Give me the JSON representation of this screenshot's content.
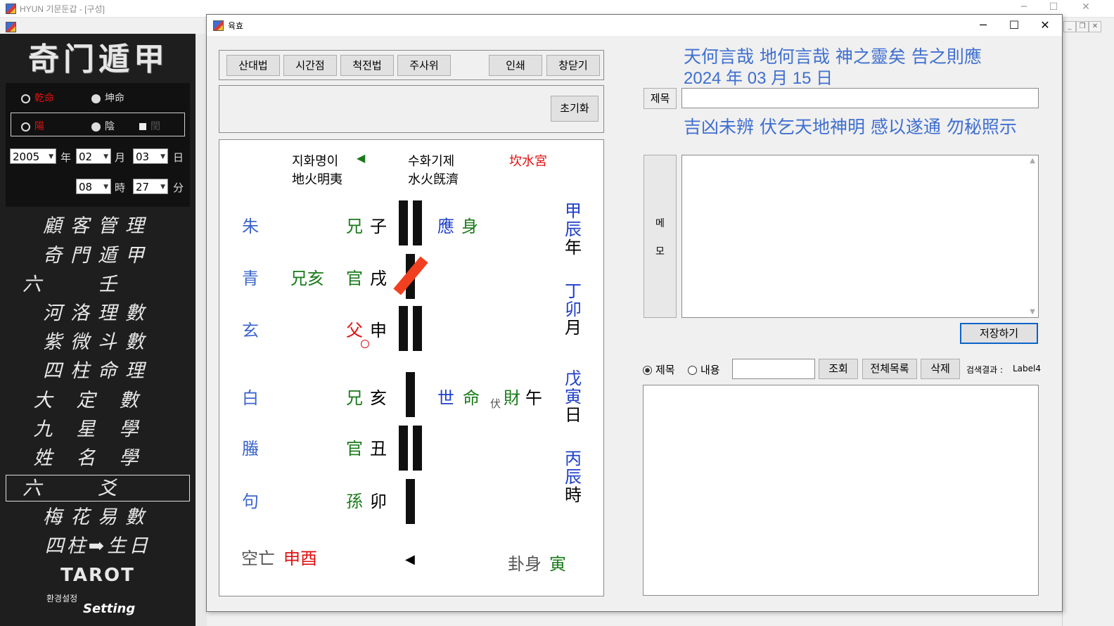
{
  "main_window": {
    "title": "HYUN 기문둔갑 - [구성]"
  },
  "left_panel": {
    "logo": "奇门遁甲",
    "gender": {
      "male": "乾命",
      "female": "坤命",
      "selected": "male"
    },
    "calendar": {
      "solar": "陽",
      "lunar": "陰",
      "leap": "閏",
      "selected": "solar"
    },
    "date": {
      "year": "2005",
      "year_unit": "年",
      "month": "02",
      "month_unit": "月",
      "day": "03",
      "day_unit": "日"
    },
    "time": {
      "hour": "08",
      "hour_unit": "時",
      "minute": "27",
      "minute_unit": "分"
    },
    "menu": [
      "顧客管理",
      "奇門遁甲",
      "六壬",
      "河洛理數",
      "紫微斗數",
      "四柱命理",
      "大定數",
      "九星學",
      "姓名學",
      "六爻",
      "梅花易數",
      "四柱➡生日",
      "TAROT"
    ],
    "active_menu": "六爻",
    "settings_ko": "환경설정",
    "settings_en": "Setting"
  },
  "dialog": {
    "title": "육효",
    "toolbar": [
      "산대법",
      "시간점",
      "척전법",
      "주사위"
    ],
    "print_label": "인쇄",
    "close_label": "창닫기",
    "reset_label": "초기화",
    "hexagram": {
      "name_ko": "지화명이",
      "arrow": "◀",
      "name_hanja": "地火明夷",
      "changed_ko": "수화기제",
      "changed_hanja": "水火旣濟",
      "palace": "坎水宮",
      "lines": [
        {
          "spirit": "朱",
          "hidden": "",
          "relation": "兄",
          "branch": "子",
          "mark": "應",
          "extra": "身",
          "fushen_tag": "",
          "fushen": "",
          "fushen_branch": ""
        },
        {
          "spirit": "青",
          "hidden": "兄亥",
          "relation": "官",
          "branch": "戌",
          "mark": "",
          "extra": "",
          "fushen_tag": "",
          "fushen": "",
          "fushen_branch": ""
        },
        {
          "spirit": "玄",
          "hidden": "",
          "relation": "父",
          "branch": "申",
          "mark": "",
          "extra": "",
          "fushen_tag": "",
          "fushen": "",
          "fushen_branch": ""
        },
        {
          "spirit": "白",
          "hidden": "",
          "relation": "兄",
          "branch": "亥",
          "mark": "世",
          "extra": "命",
          "fushen_tag": "伏",
          "fushen": "財",
          "fushen_branch": "午"
        },
        {
          "spirit": "螣",
          "hidden": "",
          "relation": "官",
          "branch": "丑",
          "mark": "",
          "extra": "",
          "fushen_tag": "",
          "fushen": "",
          "fushen_branch": ""
        },
        {
          "spirit": "句",
          "hidden": "",
          "relation": "孫",
          "branch": "卯",
          "mark": "",
          "extra": "",
          "fushen_tag": "",
          "fushen": "",
          "fushen_branch": ""
        }
      ],
      "pillars": [
        {
          "stem": "甲",
          "branch": "辰",
          "unit": "年"
        },
        {
          "stem": "丁",
          "branch": "卯",
          "unit": "月"
        },
        {
          "stem": "戊",
          "branch": "寅",
          "unit": "日"
        },
        {
          "stem": "丙",
          "branch": "辰",
          "unit": "時"
        }
      ],
      "kongwang_label": "空亡",
      "kongwang": "申酉",
      "bottom_arrow": "◀",
      "guashen_label": "卦身",
      "guashen": "寅"
    },
    "right": {
      "invocation1": "天何言哉  地何言哉  神之靈矣  告之則應",
      "date_line": "2024 年 03 月 15 日",
      "title_label": "제목",
      "title_value": "",
      "invocation2": "吉凶未辨  伏乞天地神明  感以遂通  勿秘照示",
      "memo_label_1": "메",
      "memo_label_2": "모",
      "memo_value": "",
      "save_label": "저장하기",
      "search_opt_title": "제목",
      "search_opt_content": "내용",
      "search_value": "",
      "query_label": "조회",
      "list_all_label": "전체목록",
      "delete_label": "삭제",
      "result_label": "검색결과 :",
      "result_value": "Label4"
    }
  }
}
